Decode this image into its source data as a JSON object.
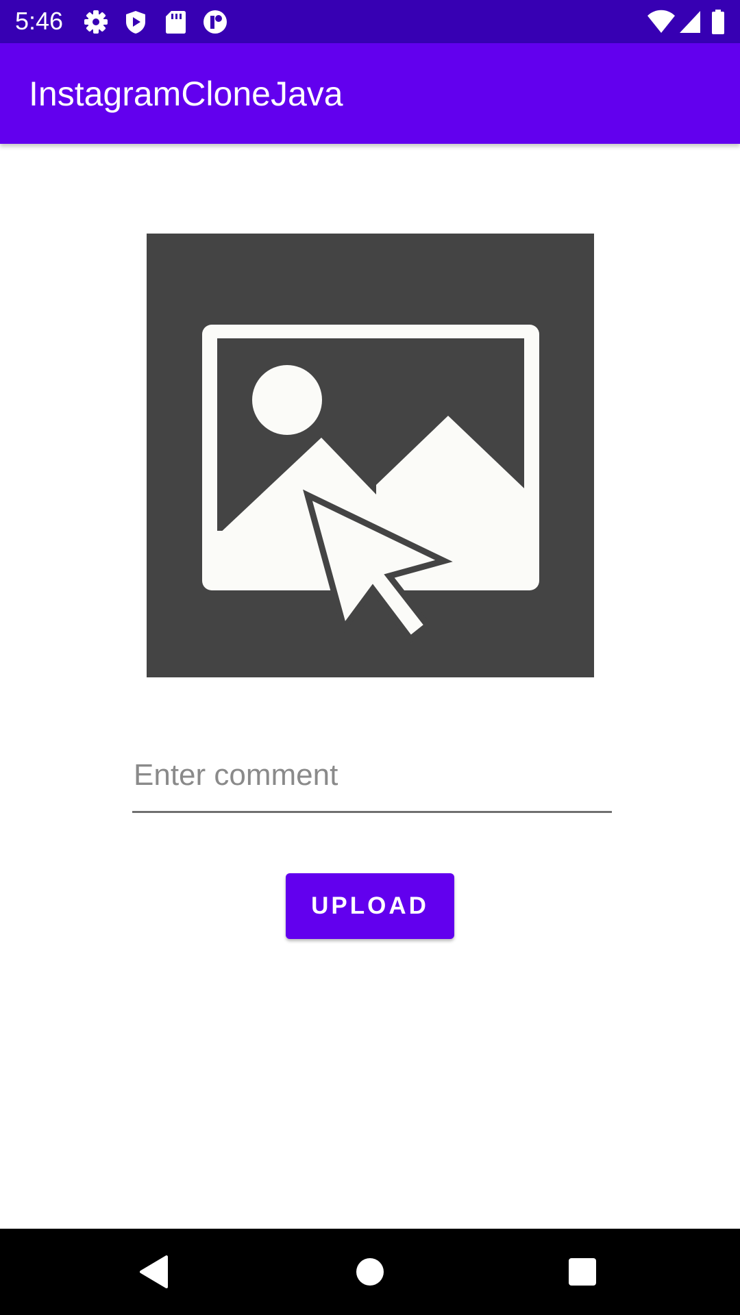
{
  "status_bar": {
    "time": "5:46",
    "background_color": "#3700b3",
    "left_icons": [
      "settings-icon",
      "play-protect-icon",
      "sd-card-icon",
      "notification-app-icon"
    ],
    "right_icons": [
      "wifi-icon",
      "cell-signal-icon",
      "battery-icon"
    ]
  },
  "app_bar": {
    "title": "InstagramCloneJava",
    "background_color": "#6200ee"
  },
  "main": {
    "image_picker": {
      "icon": "select-image-icon"
    },
    "comment_field": {
      "value": "",
      "placeholder": "Enter comment"
    },
    "upload_button": {
      "label": "UPLOAD",
      "color": "#6200ee"
    }
  },
  "nav_bar": {
    "buttons": [
      "back-icon",
      "home-icon",
      "recents-icon"
    ]
  }
}
